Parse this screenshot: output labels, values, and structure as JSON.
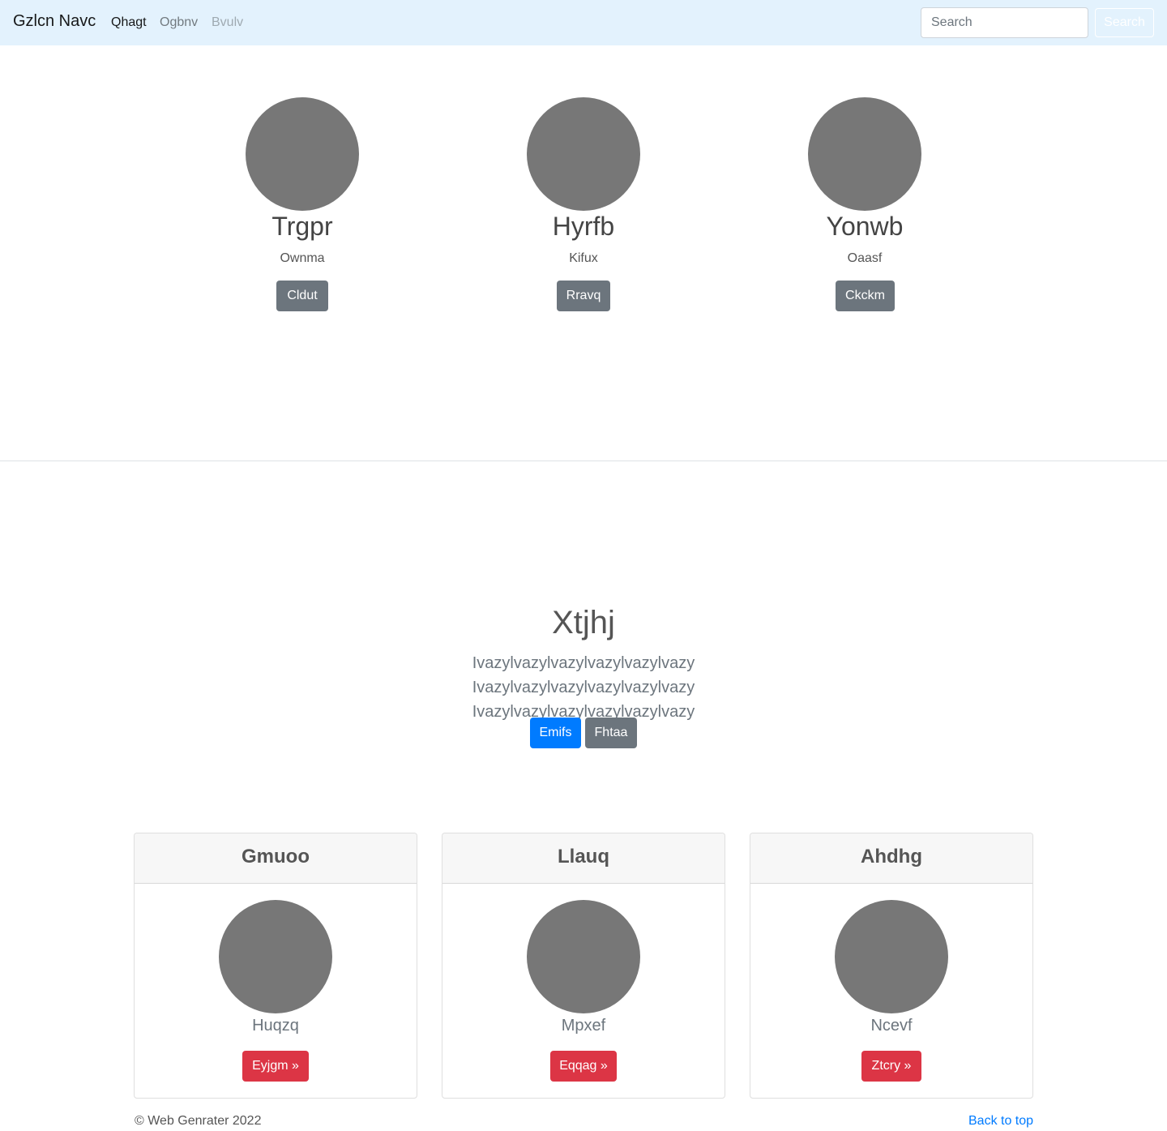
{
  "navbar": {
    "brand": "Gzlcn Navc",
    "links": [
      {
        "label": "Qhagt",
        "state": "active"
      },
      {
        "label": "Ogbnv",
        "state": "normal"
      },
      {
        "label": "Bvulv",
        "state": "disabled"
      }
    ],
    "search_placeholder": "Search",
    "search_button": "Search"
  },
  "people": [
    {
      "name": "Trgpr",
      "subtitle": "Ownma",
      "button": "Cldut"
    },
    {
      "name": "Hyrfb",
      "subtitle": "Kifux",
      "button": "Rravq"
    },
    {
      "name": "Yonwb",
      "subtitle": "Oaasf",
      "button": "Ckckm"
    }
  ],
  "hero": {
    "title": "Xtjhj",
    "text": "Ivazylvazylvazylvazylvazylvazy Ivazylvazylvazylvazylvazylvazy Ivazylvazylvazylvazylvazylvazy",
    "primary_button": "Emifs",
    "secondary_button": "Fhtaa"
  },
  "cards": [
    {
      "title": "Gmuoo",
      "subtitle": "Huqzq",
      "button": "Eyjgm »"
    },
    {
      "title": "Llauq",
      "subtitle": "Mpxef",
      "button": "Eqqag »"
    },
    {
      "title": "Ahdhg",
      "subtitle": "Ncevf",
      "button": "Ztcry »"
    }
  ],
  "footer": {
    "copyright": "© Web Genrater 2022",
    "back_to_top": "Back to top"
  },
  "colors": {
    "navbar_bg": "#e3f2fd",
    "avatar": "#777777",
    "primary": "#007bff",
    "secondary": "#6c757d",
    "danger": "#dc3545"
  }
}
